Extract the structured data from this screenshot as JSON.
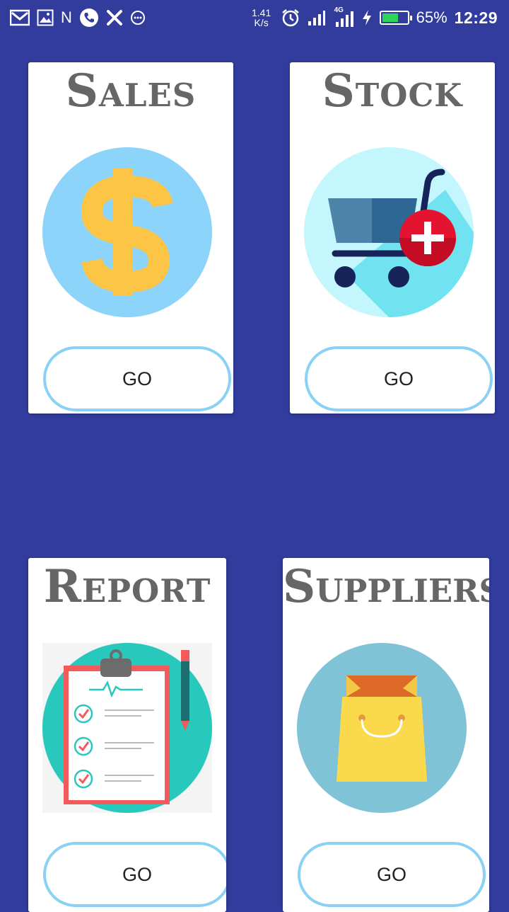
{
  "status_bar": {
    "net_speed_value": "1.41",
    "net_speed_unit": "K/s",
    "network_type": "4G",
    "battery_percent": "65%",
    "battery_level": 0.65,
    "time": "12:29",
    "notification_letter": "N"
  },
  "cards": [
    {
      "title": "Sales",
      "button_label": "GO",
      "icon": "dollar-sign-icon"
    },
    {
      "title": "Stock",
      "button_label": "GO",
      "icon": "shopping-cart-add-icon"
    },
    {
      "title": "Report",
      "button_label": "GO",
      "icon": "clipboard-checklist-icon"
    },
    {
      "title": "Suppliers",
      "button_label": "GO",
      "icon": "shopping-bag-icon"
    }
  ],
  "colors": {
    "background": "#313c9d",
    "button_border": "#8ad2f4",
    "title_text": "#666666",
    "battery_fill": "#2ed45a"
  }
}
